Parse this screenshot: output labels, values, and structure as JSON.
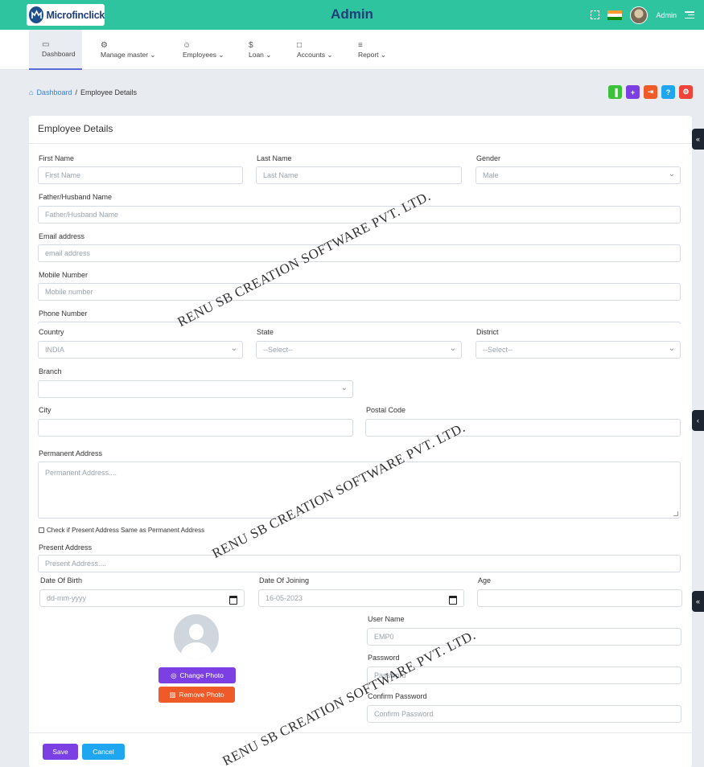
{
  "header": {
    "logo_text": "Microfinclick",
    "title": "Admin",
    "user_name": "Admin",
    "accent_color": "#2ec4a0"
  },
  "nav": {
    "items": [
      {
        "label": "Dashboard",
        "icon": "monitor-icon",
        "active": true
      },
      {
        "label": "Manage master",
        "icon": "settings-icon",
        "dropdown": true
      },
      {
        "label": "Employees",
        "icon": "user-icon",
        "dropdown": true
      },
      {
        "label": "Loan",
        "icon": "dollar-icon",
        "dropdown": true
      },
      {
        "label": "Accounts",
        "icon": "book-icon",
        "dropdown": true
      },
      {
        "label": "Report",
        "icon": "layers-icon",
        "dropdown": true
      }
    ]
  },
  "breadcrumb": {
    "home": "Dashboard",
    "separator": "/",
    "current": "Employee Details"
  },
  "action_buttons": [
    {
      "icon": "chart-icon",
      "color": "#3cc13b"
    },
    {
      "icon": "plus-icon",
      "color": "#7b3fe4"
    },
    {
      "icon": "login-icon",
      "color": "#f05a28"
    },
    {
      "icon": "help-icon",
      "color": "#1ea7f0"
    },
    {
      "icon": "gear-icon",
      "color": "#f0433a"
    }
  ],
  "form": {
    "title": "Employee Details",
    "first_name": {
      "label": "First Name",
      "placeholder": "First Name"
    },
    "last_name": {
      "label": "Last Name",
      "placeholder": "Last Name"
    },
    "gender": {
      "label": "Gender",
      "value": "Male"
    },
    "father_name": {
      "label": "Father/Husband Name",
      "placeholder": "Father/Husband Name"
    },
    "email": {
      "label": "Email address",
      "placeholder": "email address"
    },
    "mobile": {
      "label": "Mobile Number",
      "placeholder": "Mobile number"
    },
    "phone": {
      "label": "Phone Number"
    },
    "country": {
      "label": "Country",
      "value": "INDIA"
    },
    "state": {
      "label": "State",
      "value": "--Select--"
    },
    "district": {
      "label": "District",
      "value": "--Select--"
    },
    "branch": {
      "label": "Branch",
      "value": ""
    },
    "city": {
      "label": "City"
    },
    "postal_code": {
      "label": "Postal Code"
    },
    "permanent_address": {
      "label": "Permanent Address",
      "placeholder": "Permanent Address...."
    },
    "same_address_check": "Check if Present Address Same as Permanent Address",
    "present_address": {
      "label": "Present Address",
      "placeholder": "Present Address...."
    },
    "dob": {
      "label": "Date Of Birth",
      "value": "dd-mm-yyyy"
    },
    "doj": {
      "label": "Date Of Joining",
      "value": "16-05-2023"
    },
    "age": {
      "label": "Age"
    },
    "username": {
      "label": "User Name",
      "value": "EMP0"
    },
    "password": {
      "label": "Password",
      "placeholder": "Password"
    },
    "confirm_password": {
      "label": "Confirm Password",
      "placeholder": "Confirm Password"
    },
    "change_photo": "Change Photo",
    "remove_photo": "Remove Photo",
    "save": "Save",
    "cancel": "Cancel"
  },
  "watermark": "RENU SB CREATION SOFTWARE PVT. LTD."
}
